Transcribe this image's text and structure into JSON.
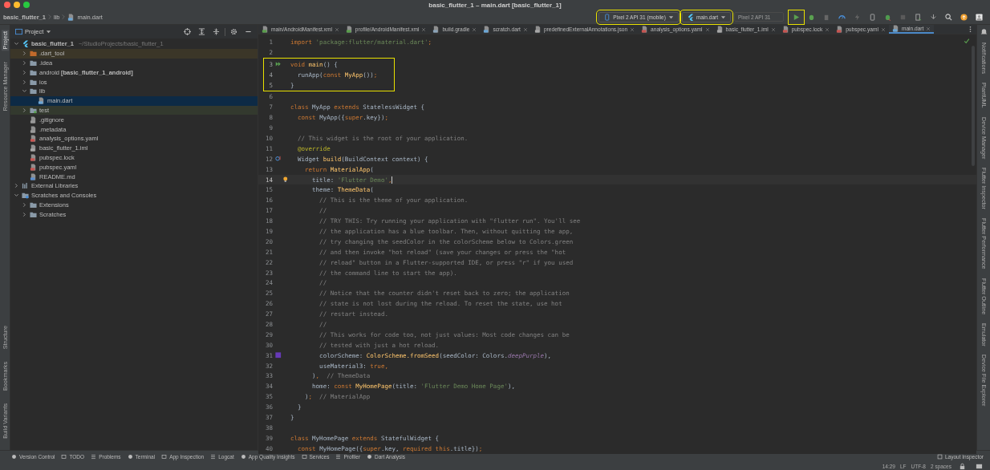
{
  "window": {
    "title": "basic_flutter_1 – main.dart [basic_flutter_1]"
  },
  "breadcrumb": [
    "basic_flutter_1",
    "lib",
    "main.dart"
  ],
  "toolbar": {
    "device": {
      "label": "Pixel 2 API 31 (mobile)",
      "highlighted": true
    },
    "config": {
      "label": "main.dart",
      "highlighted": true
    },
    "target": {
      "placeholder": "Pixel 2 API 31"
    },
    "run": {
      "highlighted": true
    }
  },
  "left_strip": {
    "top": [
      {
        "label": "Project",
        "selected": true
      },
      {
        "label": "Resource Manager",
        "selected": false
      }
    ],
    "bottom": [
      {
        "label": "Structure",
        "selected": false
      },
      {
        "label": "Bookmarks",
        "selected": false
      },
      {
        "label": "Build Variants",
        "selected": false
      }
    ]
  },
  "right_strip": [
    {
      "label": "Notifications"
    },
    {
      "label": "PlantUML"
    },
    {
      "label": "Device Manager"
    },
    {
      "label": "Flutter Inspector"
    },
    {
      "label": "Flutter Performance"
    },
    {
      "label": "Flutter Outline"
    },
    {
      "label": "Emulator"
    },
    {
      "label": "Device File Explorer"
    }
  ],
  "project": {
    "title": "Project",
    "tree": [
      {
        "name": "basic_flutter_1",
        "path": "~/StudioProjects/basic_flutter_1",
        "kind": "project",
        "expanded": true,
        "selected": false,
        "children": [
          {
            "name": ".dart_tool",
            "kind": "excluded",
            "expanded": false,
            "selected": false
          },
          {
            "name": ".idea",
            "kind": "config",
            "expanded": false,
            "selected": false
          },
          {
            "name": "android",
            "note": "[basic_flutter_1_android]",
            "kind": "module",
            "expanded": false,
            "selected": false
          },
          {
            "name": "ios",
            "kind": "module",
            "expanded": false,
            "selected": false
          },
          {
            "name": "lib",
            "kind": "folder",
            "expanded": true,
            "selected": false,
            "children": [
              {
                "name": "main.dart",
                "kind": "dart",
                "selected": true
              }
            ]
          },
          {
            "name": "test",
            "kind": "test",
            "expanded": false,
            "selected": false
          },
          {
            "name": ".gitignore",
            "kind": "file",
            "selected": false
          },
          {
            "name": ".metadata",
            "kind": "file",
            "selected": false
          },
          {
            "name": "analysis_options.yaml",
            "kind": "yaml",
            "selected": false
          },
          {
            "name": "basic_flutter_1.iml",
            "kind": "iml",
            "selected": false
          },
          {
            "name": "pubspec.lock",
            "kind": "yaml",
            "selected": false
          },
          {
            "name": "pubspec.yaml",
            "kind": "yaml",
            "selected": false
          },
          {
            "name": "README.md",
            "kind": "md",
            "selected": false
          }
        ]
      },
      {
        "name": "External Libraries",
        "kind": "libraries",
        "expanded": false,
        "selected": false
      },
      {
        "name": "Scratches and Consoles",
        "kind": "scratches",
        "expanded": true,
        "selected": false,
        "children": [
          {
            "name": "Extensions",
            "kind": "folder",
            "expanded": false,
            "selected": false
          },
          {
            "name": "Scratches",
            "kind": "folder",
            "expanded": false,
            "selected": false
          }
        ]
      }
    ]
  },
  "tabs": [
    {
      "label": "main/AndroidManifest.xml",
      "kind": "xml",
      "selected": false
    },
    {
      "label": "profile/AndroidManifest.xml",
      "kind": "xml",
      "selected": false
    },
    {
      "label": "build.gradle",
      "kind": "gradle",
      "selected": false
    },
    {
      "label": "scratch.dart",
      "kind": "dart",
      "selected": false
    },
    {
      "label": "predefinedExternalAnnotations.json",
      "kind": "json",
      "selected": false
    },
    {
      "label": "analysis_options.yaml",
      "kind": "yaml",
      "selected": false
    },
    {
      "label": "basic_flutter_1.iml",
      "kind": "iml",
      "selected": false
    },
    {
      "label": "pubspec.lock",
      "kind": "yaml",
      "selected": false
    },
    {
      "label": "pubspec.yaml",
      "kind": "yaml",
      "selected": false
    },
    {
      "label": "main.dart",
      "kind": "dart",
      "selected": true
    }
  ],
  "code": {
    "lines": [
      {
        "number": "1",
        "highlighted": false,
        "current": false,
        "tokens": [
          {
            "kind": "kw",
            "text": "import "
          },
          {
            "kind": "str",
            "text": "'package:flutter/material.dart'"
          },
          {
            "kind": "kw",
            "text": ";"
          }
        ]
      },
      {
        "number": "2",
        "highlighted": false,
        "current": false
      },
      {
        "number": "3",
        "highlighted": true,
        "current": false,
        "kind": "run",
        "tokens": [
          {
            "kind": "kw",
            "text": "void "
          },
          {
            "kind": "call",
            "text": "main"
          },
          {
            "kind": "plain",
            "text": "() {"
          }
        ]
      },
      {
        "number": "4",
        "highlighted": true,
        "current": false,
        "tokens": [
          {
            "kind": "plain",
            "text": "  runApp("
          },
          {
            "kind": "kw",
            "text": "const "
          },
          {
            "kind": "call",
            "text": "MyApp"
          },
          {
            "kind": "plain",
            "text": "())"
          },
          {
            "kind": "kw",
            "text": ";"
          }
        ]
      },
      {
        "number": "5",
        "highlighted": true,
        "current": false,
        "tokens": [
          {
            "kind": "plain",
            "text": "}"
          }
        ]
      },
      {
        "number": "6",
        "highlighted": false,
        "current": false
      },
      {
        "number": "7",
        "highlighted": false,
        "current": false,
        "tokens": [
          {
            "kind": "kw",
            "text": "class "
          },
          {
            "kind": "plain",
            "text": "MyApp "
          },
          {
            "kind": "kw",
            "text": "extends "
          },
          {
            "kind": "plain",
            "text": "StatelessWidget {"
          }
        ]
      },
      {
        "number": "8",
        "highlighted": false,
        "current": false,
        "tokens": [
          {
            "kind": "kw",
            "text": "  const "
          },
          {
            "kind": "plain",
            "text": "MyApp({"
          },
          {
            "kind": "kw",
            "text": "super"
          },
          {
            "kind": "plain",
            "text": ".key})"
          },
          {
            "kind": "kw",
            "text": ";"
          }
        ]
      },
      {
        "number": "9",
        "highlighted": false,
        "current": false
      },
      {
        "number": "10",
        "highlighted": false,
        "current": false,
        "tokens": [
          {
            "kind": "cmt",
            "text": "  // This widget is the root of your application."
          }
        ]
      },
      {
        "number": "11",
        "highlighted": false,
        "current": false,
        "tokens": [
          {
            "kind": "ann",
            "text": "  @override"
          }
        ]
      },
      {
        "number": "12",
        "highlighted": false,
        "current": false,
        "kind": "override",
        "tokens": [
          {
            "kind": "plain",
            "text": "  Widget "
          },
          {
            "kind": "call",
            "text": "build"
          },
          {
            "kind": "plain",
            "text": "(BuildContext context) {"
          }
        ]
      },
      {
        "number": "13",
        "highlighted": false,
        "current": false,
        "tokens": [
          {
            "kind": "kw",
            "text": "    return "
          },
          {
            "kind": "call",
            "text": "MaterialApp"
          },
          {
            "kind": "plain",
            "text": "("
          }
        ]
      },
      {
        "number": "14",
        "highlighted": false,
        "current": true,
        "kind": "bulb",
        "tokens": [
          {
            "kind": "plain",
            "text": "      title: "
          },
          {
            "kind": "str",
            "text": "'Flutter Demo'"
          },
          {
            "kind": "kw",
            "text": ","
          }
        ]
      },
      {
        "number": "15",
        "highlighted": false,
        "current": false,
        "tokens": [
          {
            "kind": "plain",
            "text": "      theme: "
          },
          {
            "kind": "call",
            "text": "ThemeData"
          },
          {
            "kind": "plain",
            "text": "("
          }
        ]
      },
      {
        "number": "16",
        "highlighted": false,
        "current": false,
        "tokens": [
          {
            "kind": "cmt",
            "text": "        // This is the theme of your application."
          }
        ]
      },
      {
        "number": "17",
        "highlighted": false,
        "current": false,
        "tokens": [
          {
            "kind": "cmt",
            "text": "        //"
          }
        ]
      },
      {
        "number": "18",
        "highlighted": false,
        "current": false,
        "tokens": [
          {
            "kind": "cmt",
            "text": "        // TRY THIS: Try running your application with \"flutter run\". You'll see"
          }
        ]
      },
      {
        "number": "19",
        "highlighted": false,
        "current": false,
        "tokens": [
          {
            "kind": "cmt",
            "text": "        // the application has a blue toolbar. Then, without quitting the app,"
          }
        ]
      },
      {
        "number": "20",
        "highlighted": false,
        "current": false,
        "tokens": [
          {
            "kind": "cmt",
            "text": "        // try changing the seedColor in the colorScheme below to Colors.green"
          }
        ]
      },
      {
        "number": "21",
        "highlighted": false,
        "current": false,
        "tokens": [
          {
            "kind": "cmt",
            "text": "        // and then invoke \"hot reload\" (save your changes or press the \"hot"
          }
        ]
      },
      {
        "number": "22",
        "highlighted": false,
        "current": false,
        "tokens": [
          {
            "kind": "cmt",
            "text": "        // reload\" button in a Flutter-supported IDE, or press \"r\" if you used"
          }
        ]
      },
      {
        "number": "23",
        "highlighted": false,
        "current": false,
        "tokens": [
          {
            "kind": "cmt",
            "text": "        // the command line to start the app)."
          }
        ]
      },
      {
        "number": "24",
        "highlighted": false,
        "current": false,
        "tokens": [
          {
            "kind": "cmt",
            "text": "        //"
          }
        ]
      },
      {
        "number": "25",
        "highlighted": false,
        "current": false,
        "tokens": [
          {
            "kind": "cmt",
            "text": "        // Notice that the counter didn't reset back to zero; the application"
          }
        ]
      },
      {
        "number": "26",
        "highlighted": false,
        "current": false,
        "tokens": [
          {
            "kind": "cmt",
            "text": "        // state is not lost during the reload. To reset the state, use hot"
          }
        ]
      },
      {
        "number": "27",
        "highlighted": false,
        "current": false,
        "tokens": [
          {
            "kind": "cmt",
            "text": "        // restart instead."
          }
        ]
      },
      {
        "number": "28",
        "highlighted": false,
        "current": false,
        "tokens": [
          {
            "kind": "cmt",
            "text": "        //"
          }
        ]
      },
      {
        "number": "29",
        "highlighted": false,
        "current": false,
        "tokens": [
          {
            "kind": "cmt",
            "text": "        // This works for code too, not just values: Most code changes can be"
          }
        ]
      },
      {
        "number": "30",
        "highlighted": false,
        "current": false,
        "tokens": [
          {
            "kind": "cmt",
            "text": "        // tested with just a hot reload."
          }
        ]
      },
      {
        "number": "31",
        "highlighted": false,
        "current": false,
        "kind": "swatch",
        "tokens": [
          {
            "kind": "plain",
            "text": "        colorScheme: "
          },
          {
            "kind": "call",
            "text": "ColorScheme.fromSeed"
          },
          {
            "kind": "plain",
            "text": "(seedColor: Colors."
          },
          {
            "kind": "const",
            "text": "deepPurple"
          },
          {
            "kind": "plain",
            "text": "),"
          }
        ]
      },
      {
        "number": "32",
        "highlighted": false,
        "current": false,
        "tokens": [
          {
            "kind": "plain",
            "text": "        useMaterial3: "
          },
          {
            "kind": "kw",
            "text": "true,"
          }
        ]
      },
      {
        "number": "33",
        "highlighted": false,
        "current": false,
        "tokens": [
          {
            "kind": "plain",
            "text": "      )"
          },
          {
            "kind": "kw",
            "text": ","
          },
          {
            "kind": "cmt",
            "text": "  // ThemeData"
          }
        ]
      },
      {
        "number": "34",
        "highlighted": false,
        "current": false,
        "tokens": [
          {
            "kind": "plain",
            "text": "      home: "
          },
          {
            "kind": "kw",
            "text": "const "
          },
          {
            "kind": "call",
            "text": "MyHomePage"
          },
          {
            "kind": "plain",
            "text": "(title: "
          },
          {
            "kind": "str",
            "text": "'Flutter Demo Home Page'"
          },
          {
            "kind": "plain",
            "text": "),"
          }
        ]
      },
      {
        "number": "35",
        "highlighted": false,
        "current": false,
        "tokens": [
          {
            "kind": "plain",
            "text": "    )"
          },
          {
            "kind": "kw",
            "text": ";"
          },
          {
            "kind": "cmt",
            "text": "  // MaterialApp"
          }
        ]
      },
      {
        "number": "36",
        "highlighted": false,
        "current": false,
        "tokens": [
          {
            "kind": "plain",
            "text": "  }"
          }
        ]
      },
      {
        "number": "37",
        "highlighted": false,
        "current": false,
        "tokens": [
          {
            "kind": "plain",
            "text": "}"
          }
        ]
      },
      {
        "number": "38",
        "highlighted": false,
        "current": false
      },
      {
        "number": "39",
        "highlighted": false,
        "current": false,
        "tokens": [
          {
            "kind": "kw",
            "text": "class "
          },
          {
            "kind": "plain",
            "text": "MyHomePage "
          },
          {
            "kind": "kw",
            "text": "extends "
          },
          {
            "kind": "plain",
            "text": "StatefulWidget {"
          }
        ]
      },
      {
        "number": "40",
        "highlighted": false,
        "current": false,
        "tokens": [
          {
            "kind": "kw",
            "text": "  const "
          },
          {
            "kind": "plain",
            "text": "MyHomePage({"
          },
          {
            "kind": "kw",
            "text": "super"
          },
          {
            "kind": "plain",
            "text": ".key, "
          },
          {
            "kind": "kw",
            "text": "required this"
          },
          {
            "kind": "plain",
            "text": ".title})"
          },
          {
            "kind": "kw",
            "text": ";"
          }
        ]
      }
    ]
  },
  "tool_windows": {
    "left": [
      "Version Control",
      "TODO",
      "Problems",
      "Terminal",
      "App Inspection",
      "Logcat",
      "App Quality Insights",
      "Services",
      "Profiler",
      "Dart Analysis"
    ],
    "right": [
      "Layout Inspector"
    ]
  },
  "status_bar": [
    "14:29",
    "LF",
    "UTF-8",
    "2 spaces"
  ]
}
